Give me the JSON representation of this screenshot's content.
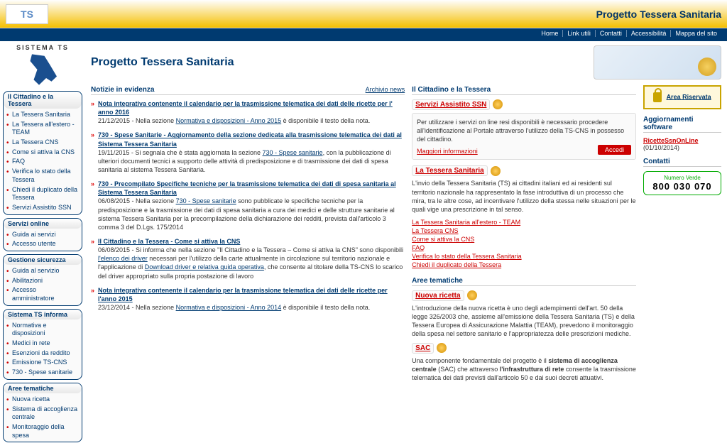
{
  "top": {
    "logo": "TS",
    "title": "Progetto Tessera Sanitaria"
  },
  "nav": [
    "Home",
    "Link utili",
    "Contatti",
    "Accessibilità",
    "Mappa del sito"
  ],
  "logo_text": "SISTEMA TS",
  "page_title": "Progetto Tessera Sanitaria",
  "side_sections": [
    {
      "title": "Il Cittadino e la Tessera",
      "items": [
        "La Tessera Sanitaria",
        "La Tessera all'estero - TEAM",
        "La Tessera CNS",
        "Come si attiva la CNS",
        "FAQ",
        "Verifica lo stato della Tessera",
        "Chiedi il duplicato della Tessera",
        "Servizi Assistito SSN"
      ]
    },
    {
      "title": "Servizi online",
      "items": [
        "Guida ai servizi",
        "Accesso utente"
      ]
    },
    {
      "title": "Gestione sicurezza",
      "items": [
        "Guida al servizio",
        "Abilitazioni",
        "Accesso amministratore"
      ]
    },
    {
      "title": "Sistema TS informa",
      "items": [
        "Normativa e disposizioni",
        "Medici in rete",
        "Esenzioni da reddito",
        "Emissione TS-CNS",
        "730 - Spese sanitarie"
      ]
    },
    {
      "title": "Aree tematiche",
      "items": [
        "Nuova ricetta",
        "Sistema di accoglienza centrale",
        "Monitoraggio della spesa"
      ]
    }
  ],
  "left": {
    "sec_title": "Notizie in evidenza",
    "sec_link": "Archivio news",
    "items": [
      {
        "title": "Nota integrativa contenente il calendario per la trasmissione telematica dei dati delle ricette per l' anno 2016",
        "pre": "21/12/2015 - Nella sezione ",
        "lnk1": "Normativa e disposizioni - Anno 2015",
        "post": " è disponibile il testo della nota."
      },
      {
        "title": "730 - Spese Sanitarie - Aggiornamento della sezione dedicata alla trasmissione telematica dei dati al Sistema Tessera Sanitaria",
        "pre": "19/11/2015 - Si segnala che è stata aggiornata la sezione ",
        "lnk1": "730 - Spese sanitarie",
        "post": ", con la pubblicazione di ulteriori documenti tecnici a supporto delle attività di predisposizione e di trasmissione dei dati di spesa sanitaria al sistema Tessera Sanitaria."
      },
      {
        "title": "730 - Precompilato Specifiche tecniche per la trasmissione telematica dei dati di spesa sanitaria al Sistema Tessera Sanitaria",
        "pre": "06/08/2015 - Nella sezione ",
        "lnk1": "730 - Spese sanitarie",
        "post": " sono pubblicate le specifiche tecniche per la predisposizione e la trasmissione dei dati di spesa sanitaria a cura dei medici e delle strutture sanitarie al sistema Tessera Sanitaria per la precompilazione della dichiarazione dei redditi, prevista dall'articolo 3 comma 3 del D.Lgs. 175/2014"
      },
      {
        "title": "Il Cittadino e la Tessera - Come si attiva la CNS",
        "pre": "06/08/2015 - Si informa che nella sezione \"Il Cittadino e la Tessera – Come si attiva la CNS\" sono disponibili ",
        "lnk1": "l'elenco dei driver",
        "mid": " necessari per l'utilizzo della carte attualmente in circolazione sul territorio nazionale e l'applicazione di ",
        "lnk2": "Download driver e relativa guida operativa",
        "post": ", che consente al titolare della TS-CNS lo scarico del driver appropriato sulla propria postazione di lavoro"
      },
      {
        "title": "Nota integrativa contenente il calendario per la trasmissione telematica dei dati delle ricette per l'anno 2015",
        "pre": "23/12/2014 - Nella sezione ",
        "lnk1": "Normativa e disposizioni - Anno 2014",
        "post": " è disponibile il testo della nota."
      }
    ]
  },
  "right": {
    "sec_title": "Il Cittadino e la Tessera",
    "srv": {
      "title": "Servizi Assistito SSN",
      "text": "Per utilizzare i servizi on line resi disponibili è necessario procedere all'identificazione al Portale attraverso l'utilizzo della TS-CNS in possesso del cittadino.",
      "more": "Maggiori informazioni",
      "btn": "Accedi"
    },
    "tess": {
      "title": "La Tessera Sanitaria",
      "text": "L'invio della Tessera Sanitaria (TS) ai cittadini italiani ed ai residenti sul territorio nazionale ha rappresentato la fase introduttiva di un processo che mira, tra le altre cose, ad incentivare l'utilizzo della stessa nelle situazioni per le quali vige una prescrizione in tal senso.",
      "links": [
        "La Tessera Sanitaria all'estero - TEAM",
        "La Tessera CNS",
        "Come si attiva la CNS",
        "FAQ",
        "Verifica lo stato della Tessera Sanitaria",
        "Chiedi il duplicato della Tessera"
      ]
    },
    "aree_title": "Aree tematiche",
    "ric": {
      "title": "Nuova ricetta",
      "text": "L'introduzione della nuova ricetta è uno degli adempimenti dell'art. 50 della legge 326/2003 che, assieme all'emissione della Tessera Sanitaria (TS) e della Tessera Europea di Assicurazione Malattia (TEAM), prevedono il monitoraggio della spesa nel settore sanitario e l'appropriatezza delle prescrizioni mediche."
    },
    "sac": {
      "title": "SAC",
      "pre": "Una componente fondamentale del progetto è il ",
      "bold": "sistema di accoglienza centrale",
      "mid": " (SAC) che attraverso ",
      "bold2": "l'infrastruttura di rete",
      "post": " consente la trasmissione telematica dei dati previsti dall'articolo 50 e dai suoi decreti attuativi."
    }
  },
  "extra": {
    "reserved": "Area Riservata",
    "sw_title": "Aggiornamenti software",
    "sw_link": "RicetteSsnOnLine",
    "sw_date": "(01/10/2014)",
    "contacts": "Contatti",
    "nv_lbl": "Numero Verde",
    "nv_num": "800 030 070"
  }
}
